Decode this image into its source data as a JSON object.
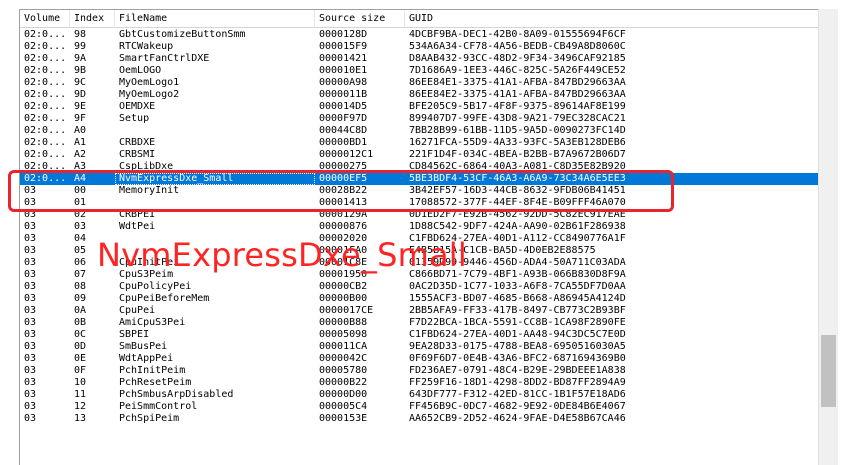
{
  "columns": [
    "Volume",
    "Index",
    "FileName",
    "Source size",
    "GUID"
  ],
  "rows": [
    [
      "02:0...",
      "98",
      "GbtCustomizeButtonSmm",
      "0000128D",
      "4DCBF9BA-DEC1-42B0-8A09-01555694F6CF"
    ],
    [
      "02:0...",
      "99",
      "RTCWakeup",
      "000015F9",
      "534A6A34-CF78-4A56-BEDB-CB49A8D8060C"
    ],
    [
      "02:0...",
      "9A",
      "SmartFanCtrlDXE",
      "00001421",
      "D8AAB432-93CC-48D2-9F34-3496CAF92185"
    ],
    [
      "02:0...",
      "9B",
      "OemLOGO",
      "000010E1",
      "7D1686A9-1EE3-446C-825C-5A26F449CE52"
    ],
    [
      "02:0...",
      "9C",
      "MyOemLogo1",
      "00000A98",
      "86EE84E1-3375-41A1-AFBA-847BD29663AA"
    ],
    [
      "02:0...",
      "9D",
      "MyOemLogo2",
      "0000011B",
      "86EE84E2-3375-41A1-AFBA-847BD29663AA"
    ],
    [
      "02:0...",
      "9E",
      "OEMDXE",
      "000014D5",
      "BFE205C9-5B17-4F8F-9375-89614AF8E199"
    ],
    [
      "02:0...",
      "9F",
      "Setup",
      "0000F97D",
      "899407D7-99FE-43D8-9A21-79EC328CAC21"
    ],
    [
      "02:0...",
      "A0",
      "",
      "00044C8D",
      "7BB28B99-61BB-11D5-9A5D-0090273FC14D"
    ],
    [
      "02:0...",
      "A1",
      "CRBDXE",
      "00000BD1",
      "16271FCA-55D9-4A33-93FC-5A3EB128DEB6"
    ],
    [
      "02:0...",
      "A2",
      "CRBSMI",
      "0000012C1",
      "221F1D4F-034C-4BEA-B2BB-B7A9672B06D7"
    ],
    [
      "02:0...",
      "A3",
      "CspLibDxe",
      "00000275",
      "CD84562C-6864-40A3-A081-C8D35E82B920"
    ],
    [
      "02:0...",
      "A4",
      "NvmExpressDxe_Small",
      "00000EF5",
      "5BE3BDF4-53CF-46A3-A6A9-73C34A6E5EE3"
    ],
    [
      "03",
      "00",
      "MemoryInit",
      "00028B22",
      "3B42EF57-16D3-44CB-8632-9FDB06B41451"
    ],
    [
      "03",
      "01",
      "",
      "00001413",
      "17088572-377F-44EF-8F4E-B09FFF46A070"
    ],
    [
      "03",
      "02",
      "CRBPEI",
      "0000129A",
      "0D1ED2F7-E92B-4562-92DD-5C82EC917EAE"
    ],
    [
      "03",
      "03",
      "WdtPei",
      "00000876",
      "1D88C542-9DF7-424A-AA90-02B61F286938"
    ],
    [
      "03",
      "04",
      "",
      "00002020",
      "C1FBD624-27EA-40D1-A112-CC8490776A1F"
    ],
    [
      "03",
      "05",
      "",
      "00001FA0",
      "E4B5B15A-C1CB-BA5D-4D0EB2E88575"
    ],
    [
      "03",
      "06",
      "CpuInitPei",
      "00001C8E",
      "01359D99-9446-456D-ADA4-50A711C03ADA"
    ],
    [
      "03",
      "07",
      "CpuS3Peim",
      "00001950",
      "C866BD71-7C79-4BF1-A93B-066B830D8F9A"
    ],
    [
      "03",
      "08",
      "CpuPolicyPei",
      "00000CB2",
      "0AC2D35D-1C77-1033-A6F8-7CA55DF7D0AA"
    ],
    [
      "03",
      "09",
      "CpuPeiBeforeMem",
      "00000B00",
      "1555ACF3-BD07-4685-B668-A86945A4124D"
    ],
    [
      "03",
      "0A",
      "CpuPei",
      "0000017CE",
      "2BB5AFA9-FF33-417B-8497-CB773C2B93BF"
    ],
    [
      "03",
      "0B",
      "AmiCpuS3Pei",
      "00000B88",
      "F7D22BCA-1BCA-5591-CC8B-1CA98F2890FE"
    ],
    [
      "03",
      "0C",
      "SBPEI",
      "00005098",
      "C1FBD624-27EA-40D1-AA48-94C3DC5C7E0D"
    ],
    [
      "03",
      "0D",
      "SmBusPei",
      "000011CA",
      "9EA28D33-0175-4788-BEA8-6950516030A5"
    ],
    [
      "03",
      "0E",
      "WdtAppPei",
      "0000042C",
      "0F69F6D7-0E4B-43A6-BFC2-6871694369B0"
    ],
    [
      "03",
      "0F",
      "PchInitPeim",
      "00005780",
      "FD236AE7-0791-48C4-B29E-29BDEEE1A838"
    ],
    [
      "03",
      "10",
      "PchResetPeim",
      "00000B22",
      "FF259F16-18D1-4298-8DD2-BD87FF2894A9"
    ],
    [
      "03",
      "11",
      "PchSmbusArpDisabled",
      "00000D00",
      "643DF777-F312-42ED-81CC-1B1F57E18AD6"
    ],
    [
      "03",
      "12",
      "PeiSmmControl",
      "000005C4",
      "FF456B9C-0DC7-4682-9E92-0DE84B6E4067"
    ],
    [
      "03",
      "13",
      "PchSpiPeim",
      "0000153E",
      "AA652CB9-2D52-4624-9FAE-D4E58B67CA46"
    ]
  ],
  "selected_index": 12,
  "overlay_text": "NvmExpressDxe_Small",
  "colors": {
    "selection": "#0078d7",
    "annotation": "#e8242e"
  }
}
